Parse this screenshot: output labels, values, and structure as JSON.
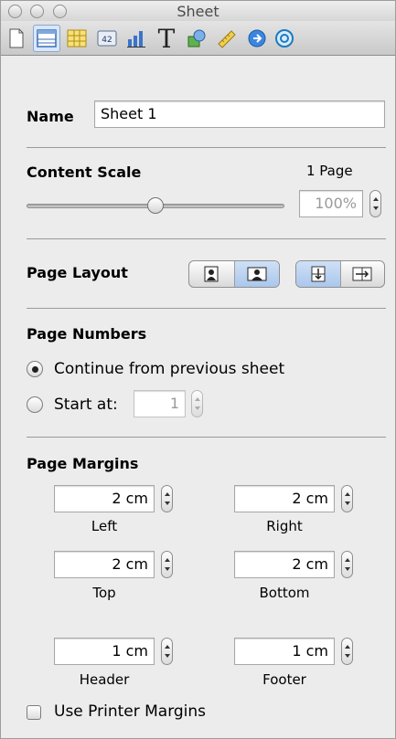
{
  "window": {
    "title": "Sheet"
  },
  "toolbar": {
    "icons": [
      "document-inspector-icon",
      "sheet-inspector-icon",
      "table-inspector-icon",
      "cell-format-inspector-icon",
      "chart-inspector-icon",
      "text-inspector-icon",
      "graphic-inspector-icon",
      "metrics-inspector-icon",
      "hyperlink-inspector-icon",
      "quicktime-inspector-icon"
    ],
    "active": "sheet-inspector-icon",
    "cell_format_badge": "42",
    "text_glyph": "T"
  },
  "name": {
    "label": "Name",
    "value": "Sheet 1"
  },
  "content_scale": {
    "label": "Content Scale",
    "pages_text": "1 Page",
    "value": "100%",
    "slider_fraction": 0.5
  },
  "page_layout": {
    "label": "Page Layout",
    "orientation_selected": "landscape",
    "order_selected": "down-then-across"
  },
  "page_numbers": {
    "label": "Page Numbers",
    "continue_label": "Continue from previous sheet",
    "start_label": "Start at:",
    "start_value": "1",
    "selected": "continue"
  },
  "page_margins": {
    "label": "Page Margins",
    "left": {
      "value": "2 cm",
      "label": "Left"
    },
    "right": {
      "value": "2 cm",
      "label": "Right"
    },
    "top": {
      "value": "2 cm",
      "label": "Top"
    },
    "bottom": {
      "value": "2 cm",
      "label": "Bottom"
    },
    "header": {
      "value": "1 cm",
      "label": "Header"
    },
    "footer": {
      "value": "1 cm",
      "label": "Footer"
    },
    "printer_margins_label": "Use Printer Margins",
    "printer_margins_checked": false
  }
}
